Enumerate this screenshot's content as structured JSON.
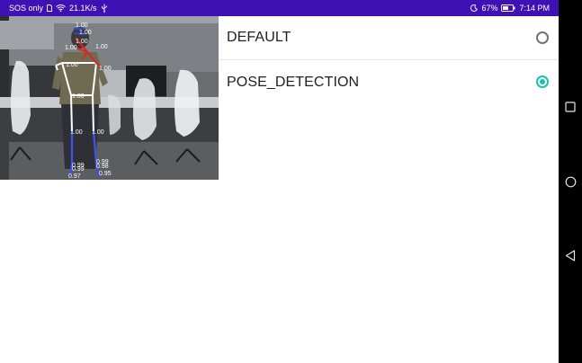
{
  "status_bar": {
    "carrier": "SOS only",
    "network_speed": "21.1K/s",
    "battery": "67%",
    "time": "7:14 PM",
    "icons": [
      "sim-icon",
      "wifi-icon",
      "usb-icon",
      "moon-icon",
      "battery-icon"
    ]
  },
  "nav_bar": {
    "buttons": [
      "recent-apps",
      "home",
      "back"
    ]
  },
  "camera_preview": {
    "keypoint_scores": [
      "0.99",
      "0.99",
      "0.98",
      "0.97",
      "0.95",
      "1.00",
      "1.00",
      "1.00",
      "1.00",
      "1.00",
      "1.00",
      "1.00",
      "1.00",
      "1.00"
    ]
  },
  "options": [
    {
      "label": "DEFAULT",
      "selected": false
    },
    {
      "label": "POSE_DETECTION",
      "selected": true
    }
  ],
  "colors": {
    "status_bar": "#3f11b4",
    "accent": "#17c2b0",
    "nav_bar": "#000000"
  }
}
